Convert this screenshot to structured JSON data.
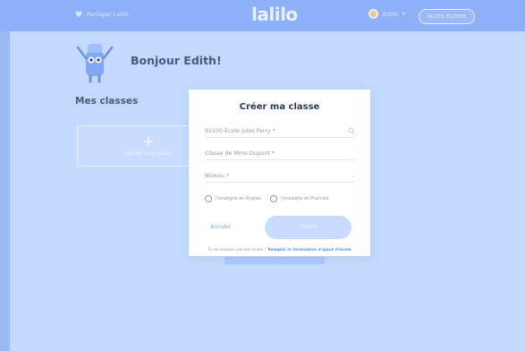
{
  "topbar": {
    "share_label": "Partager Lalilo",
    "logo_text": "lalilo",
    "user_name": "Edith",
    "user_chevron": "▾",
    "eleves_button": "ACCES ELEVES"
  },
  "main": {
    "greeting": "Bonjour Edith!",
    "section_title": "Mes classes",
    "add_class": {
      "icon": "+",
      "label": "Ajouter une classe"
    }
  },
  "modal": {
    "title": "Créer ma classe",
    "school_field": {
      "value": "92100 École Jules Ferry *",
      "icon": "search-icon"
    },
    "class_name_field": {
      "value": "Classe de Mme Dupont *"
    },
    "level_field": {
      "value": "Niveau *",
      "chevron": "⌄"
    },
    "radio_options": [
      "J'enseigne en Anglais",
      "J'enseigne en Français"
    ],
    "cancel_label": "Annuler",
    "create_label": "CRÉER",
    "footer_text": "Tu ne trouves pas ton école ? ",
    "footer_link": "Remplis le formulaire d'ajout d'école"
  },
  "colors": {
    "background": "#c3d9fd",
    "topbar": "#8eb0f8",
    "modal": "#ffffff",
    "link": "#5b93f5",
    "primary_disabled": "#c7dcfe"
  }
}
